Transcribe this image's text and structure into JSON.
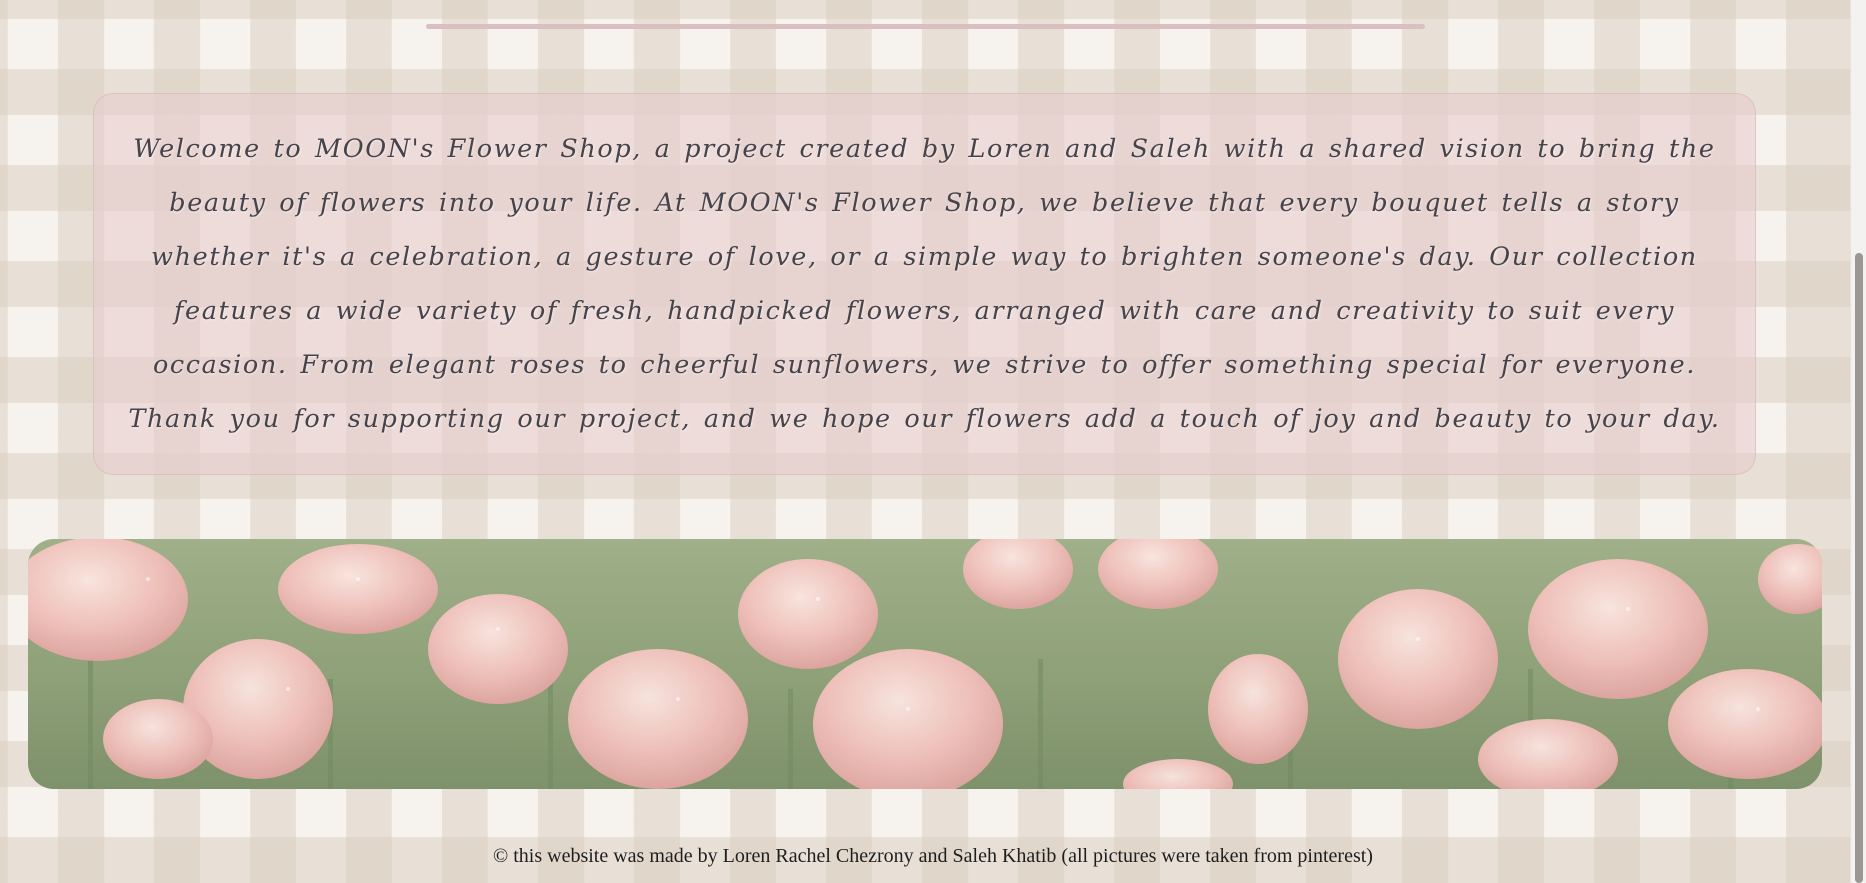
{
  "about": {
    "text": "Welcome to MOON's Flower Shop, a project created by Loren and Saleh with a shared vision to bring the beauty of flowers into your life. At MOON's Flower Shop, we believe that every bouquet tells a story whether it's a celebration, a gesture of love, or a simple way to brighten someone's day. Our collection features a wide variety of fresh, handpicked flowers, arranged with care and creativity to suit every occasion. From elegant roses to cheerful sunflowers, we strive to offer something special for everyone. Thank you for supporting our project, and we hope our flowers add a touch of joy and beauty to your day."
  },
  "footer": {
    "text": "© this website was made by Loren Rachel Chezrony and Saleh Khatib (all pictures were taken from pinterest)"
  },
  "colors": {
    "page_background": "#f6f3ef",
    "checker_stripe": "#d6cab9",
    "card_background": "#e6cdcd",
    "divider": "#d9bfc0",
    "tulip_pink": "#f2b9b4",
    "grass_green": "#7f9466"
  }
}
